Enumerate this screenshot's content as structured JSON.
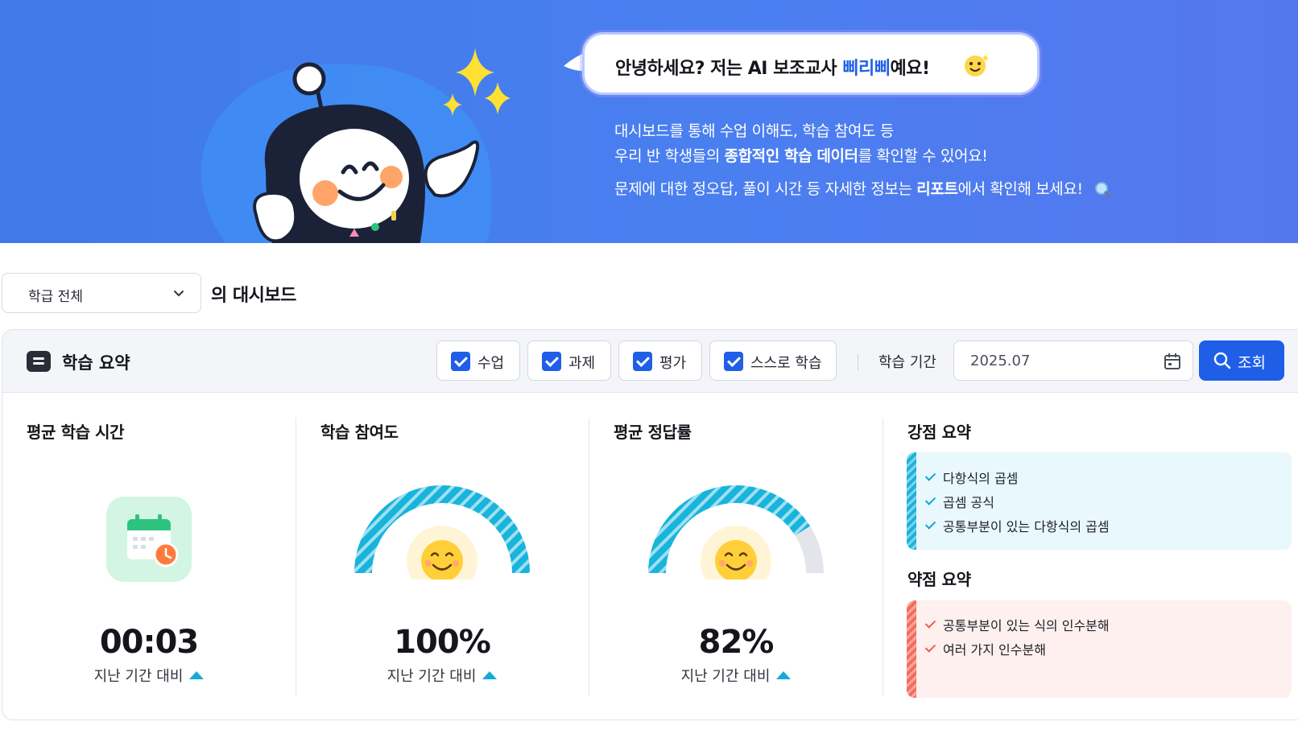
{
  "hero": {
    "bubble_prefix": "안녕하세요? 저는 AI 보조교사 ",
    "bubble_name": "삐리삐",
    "bubble_suffix": "예요!",
    "line1": "대시보드를 통해 수업 이해도, 학습 참여도 등",
    "line2_a": "우리 반 학생들의 ",
    "line2_b": "종합적인 학습 데이터",
    "line2_c": "를 확인할 수 있어요!",
    "line3_a": "문제에 대한 정오답, 풀이 시간 등 자세한 정보는 ",
    "line3_b": "리포트",
    "line3_c": "에서 확인해 보세요!",
    "robot_icon": "robot-mascot-icon"
  },
  "class_select": {
    "value": "학급 전체"
  },
  "dashboard_suffix": "의 대시보드",
  "summary": {
    "title": "학습 요약",
    "filters": [
      {
        "label": "수업",
        "checked": true
      },
      {
        "label": "과제",
        "checked": true
      },
      {
        "label": "평가",
        "checked": true
      },
      {
        "label": "스스로 학습",
        "checked": true
      }
    ],
    "period_label": "학습 기간",
    "period_value": "2025.07",
    "search_label": "조회"
  },
  "metrics": {
    "time": {
      "title": "평균 학습 시간",
      "value": "00:03",
      "compare": "지난 기간 대비"
    },
    "participation": {
      "title": "학습 참여도",
      "value": "100%",
      "compare": "지난 기간 대비",
      "fraction": 1.0
    },
    "accuracy": {
      "title": "평균 정답률",
      "value": "82%",
      "compare": "지난 기간 대비",
      "fraction": 0.82
    }
  },
  "strengths": {
    "title": "강점 요약",
    "items": [
      "다항식의 곱셈",
      "곱셈 공식",
      "공통부분이 있는 다항식의 곱셈"
    ]
  },
  "weaknesses": {
    "title": "약점 요약",
    "items": [
      "공통부분이 있는 식의 인수분해",
      "여러 가지 인수분해"
    ]
  },
  "colors": {
    "accent": "#1f5fe8",
    "gauge": "#18b4dc",
    "strong": "#14a7d3",
    "weak": "#f15d4c"
  }
}
